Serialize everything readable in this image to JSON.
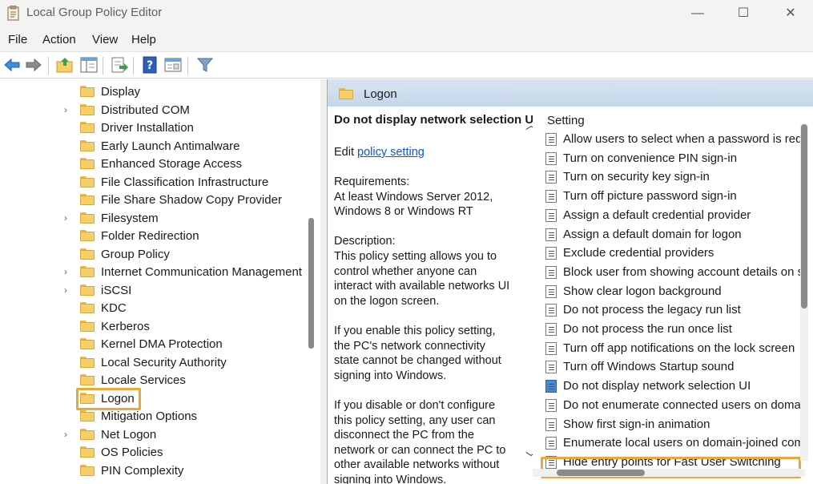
{
  "window": {
    "title": "Local Group Policy Editor",
    "minimize": "—",
    "maximize": "☐",
    "close": "✕"
  },
  "menu": [
    "File",
    "Action",
    "View",
    "Help"
  ],
  "toolbar": {
    "buttons": [
      "back-icon",
      "forward-icon",
      "up-folder-icon",
      "show-hide-tree-icon",
      "export-list-icon",
      "help-icon",
      "properties-icon",
      "filter-icon"
    ]
  },
  "tree": {
    "items": [
      {
        "label": "Display",
        "expandable": false
      },
      {
        "label": "Distributed COM",
        "expandable": true
      },
      {
        "label": "Driver Installation",
        "expandable": false
      },
      {
        "label": "Early Launch Antimalware",
        "expandable": false
      },
      {
        "label": "Enhanced Storage Access",
        "expandable": false
      },
      {
        "label": "File Classification Infrastructure",
        "expandable": false
      },
      {
        "label": "File Share Shadow Copy Provider",
        "expandable": false
      },
      {
        "label": "Filesystem",
        "expandable": true
      },
      {
        "label": "Folder Redirection",
        "expandable": false
      },
      {
        "label": "Group Policy",
        "expandable": false
      },
      {
        "label": "Internet Communication Management",
        "expandable": true
      },
      {
        "label": "iSCSI",
        "expandable": true
      },
      {
        "label": "KDC",
        "expandable": false
      },
      {
        "label": "Kerberos",
        "expandable": false
      },
      {
        "label": "Kernel DMA Protection",
        "expandable": false
      },
      {
        "label": "Local Security Authority",
        "expandable": false
      },
      {
        "label": "Locale Services",
        "expandable": false
      },
      {
        "label": "Logon",
        "expandable": false,
        "selected": true
      },
      {
        "label": "Mitigation Options",
        "expandable": false
      },
      {
        "label": "Net Logon",
        "expandable": true
      },
      {
        "label": "OS Policies",
        "expandable": false
      },
      {
        "label": "PIN Complexity",
        "expandable": false
      }
    ]
  },
  "right_pane": {
    "header_title": "Logon",
    "description": {
      "title": "Do not display network selection UI",
      "edit_prefix": "Edit ",
      "edit_link": "policy setting ",
      "lines": [
        "Requirements:",
        "At least Windows Server 2012,",
        "Windows 8 or Windows RT",
        "",
        "Description:",
        "This policy setting allows you to",
        "control whether anyone can",
        "interact with available networks UI",
        "on the logon screen.",
        "",
        "If you enable this policy setting,",
        "the PC's network connectivity",
        "state cannot be changed without",
        "signing into Windows.",
        "",
        "If you disable or don't configure",
        "this policy setting, any user can",
        "disconnect the PC from the",
        "network or can connect the PC to",
        "other available networks without",
        "signing into Windows."
      ]
    },
    "list": {
      "column_header": "Setting",
      "settings": [
        "Allow users to select when a password is requ",
        "Turn on convenience PIN sign-in",
        "Turn on security key sign-in",
        "Turn off picture password sign-in",
        "Assign a default credential provider",
        "Assign a default domain for logon",
        "Exclude credential providers",
        "Block user from showing account details on s",
        "Show clear logon background",
        "Do not process the legacy run list",
        "Do not process the run once list",
        "Turn off app notifications on the lock screen",
        "Turn off Windows Startup sound",
        "Do not display network selection UI",
        "Do not enumerate connected users on domai",
        "Show first sign-in animation",
        "Enumerate local users on domain-joined com",
        "Hide entry points for Fast User Switching"
      ],
      "selected_index": 13
    }
  },
  "colors": {
    "highlight_border": "#e8a93a",
    "link": "#0b57d0",
    "header_bg": "#c6d7ea"
  }
}
